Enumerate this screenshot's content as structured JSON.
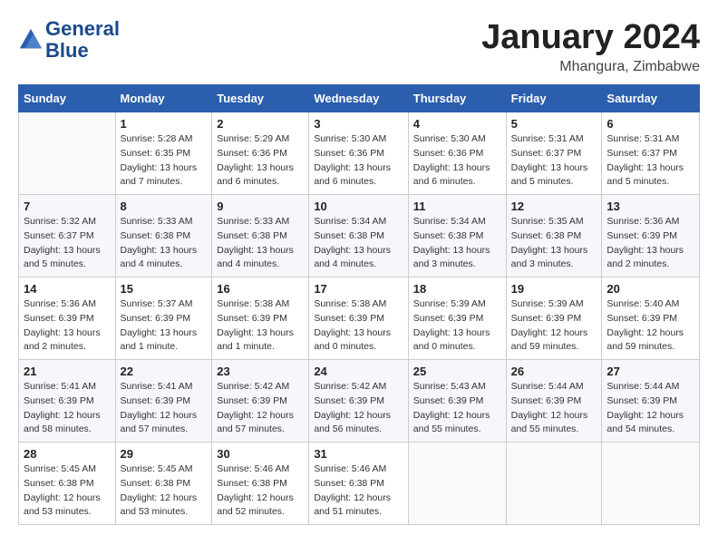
{
  "header": {
    "logo_line1": "General",
    "logo_line2": "Blue",
    "month": "January 2024",
    "location": "Mhangura, Zimbabwe"
  },
  "weekdays": [
    "Sunday",
    "Monday",
    "Tuesday",
    "Wednesday",
    "Thursday",
    "Friday",
    "Saturday"
  ],
  "weeks": [
    [
      {
        "day": "",
        "info": ""
      },
      {
        "day": "1",
        "info": "Sunrise: 5:28 AM\nSunset: 6:35 PM\nDaylight: 13 hours\nand 7 minutes."
      },
      {
        "day": "2",
        "info": "Sunrise: 5:29 AM\nSunset: 6:36 PM\nDaylight: 13 hours\nand 6 minutes."
      },
      {
        "day": "3",
        "info": "Sunrise: 5:30 AM\nSunset: 6:36 PM\nDaylight: 13 hours\nand 6 minutes."
      },
      {
        "day": "4",
        "info": "Sunrise: 5:30 AM\nSunset: 6:36 PM\nDaylight: 13 hours\nand 6 minutes."
      },
      {
        "day": "5",
        "info": "Sunrise: 5:31 AM\nSunset: 6:37 PM\nDaylight: 13 hours\nand 5 minutes."
      },
      {
        "day": "6",
        "info": "Sunrise: 5:31 AM\nSunset: 6:37 PM\nDaylight: 13 hours\nand 5 minutes."
      }
    ],
    [
      {
        "day": "7",
        "info": "Sunrise: 5:32 AM\nSunset: 6:37 PM\nDaylight: 13 hours\nand 5 minutes."
      },
      {
        "day": "8",
        "info": "Sunrise: 5:33 AM\nSunset: 6:38 PM\nDaylight: 13 hours\nand 4 minutes."
      },
      {
        "day": "9",
        "info": "Sunrise: 5:33 AM\nSunset: 6:38 PM\nDaylight: 13 hours\nand 4 minutes."
      },
      {
        "day": "10",
        "info": "Sunrise: 5:34 AM\nSunset: 6:38 PM\nDaylight: 13 hours\nand 4 minutes."
      },
      {
        "day": "11",
        "info": "Sunrise: 5:34 AM\nSunset: 6:38 PM\nDaylight: 13 hours\nand 3 minutes."
      },
      {
        "day": "12",
        "info": "Sunrise: 5:35 AM\nSunset: 6:38 PM\nDaylight: 13 hours\nand 3 minutes."
      },
      {
        "day": "13",
        "info": "Sunrise: 5:36 AM\nSunset: 6:39 PM\nDaylight: 13 hours\nand 2 minutes."
      }
    ],
    [
      {
        "day": "14",
        "info": "Sunrise: 5:36 AM\nSunset: 6:39 PM\nDaylight: 13 hours\nand 2 minutes."
      },
      {
        "day": "15",
        "info": "Sunrise: 5:37 AM\nSunset: 6:39 PM\nDaylight: 13 hours\nand 1 minute."
      },
      {
        "day": "16",
        "info": "Sunrise: 5:38 AM\nSunset: 6:39 PM\nDaylight: 13 hours\nand 1 minute."
      },
      {
        "day": "17",
        "info": "Sunrise: 5:38 AM\nSunset: 6:39 PM\nDaylight: 13 hours\nand 0 minutes."
      },
      {
        "day": "18",
        "info": "Sunrise: 5:39 AM\nSunset: 6:39 PM\nDaylight: 13 hours\nand 0 minutes."
      },
      {
        "day": "19",
        "info": "Sunrise: 5:39 AM\nSunset: 6:39 PM\nDaylight: 12 hours\nand 59 minutes."
      },
      {
        "day": "20",
        "info": "Sunrise: 5:40 AM\nSunset: 6:39 PM\nDaylight: 12 hours\nand 59 minutes."
      }
    ],
    [
      {
        "day": "21",
        "info": "Sunrise: 5:41 AM\nSunset: 6:39 PM\nDaylight: 12 hours\nand 58 minutes."
      },
      {
        "day": "22",
        "info": "Sunrise: 5:41 AM\nSunset: 6:39 PM\nDaylight: 12 hours\nand 57 minutes."
      },
      {
        "day": "23",
        "info": "Sunrise: 5:42 AM\nSunset: 6:39 PM\nDaylight: 12 hours\nand 57 minutes."
      },
      {
        "day": "24",
        "info": "Sunrise: 5:42 AM\nSunset: 6:39 PM\nDaylight: 12 hours\nand 56 minutes."
      },
      {
        "day": "25",
        "info": "Sunrise: 5:43 AM\nSunset: 6:39 PM\nDaylight: 12 hours\nand 55 minutes."
      },
      {
        "day": "26",
        "info": "Sunrise: 5:44 AM\nSunset: 6:39 PM\nDaylight: 12 hours\nand 55 minutes."
      },
      {
        "day": "27",
        "info": "Sunrise: 5:44 AM\nSunset: 6:39 PM\nDaylight: 12 hours\nand 54 minutes."
      }
    ],
    [
      {
        "day": "28",
        "info": "Sunrise: 5:45 AM\nSunset: 6:38 PM\nDaylight: 12 hours\nand 53 minutes."
      },
      {
        "day": "29",
        "info": "Sunrise: 5:45 AM\nSunset: 6:38 PM\nDaylight: 12 hours\nand 53 minutes."
      },
      {
        "day": "30",
        "info": "Sunrise: 5:46 AM\nSunset: 6:38 PM\nDaylight: 12 hours\nand 52 minutes."
      },
      {
        "day": "31",
        "info": "Sunrise: 5:46 AM\nSunset: 6:38 PM\nDaylight: 12 hours\nand 51 minutes."
      },
      {
        "day": "",
        "info": ""
      },
      {
        "day": "",
        "info": ""
      },
      {
        "day": "",
        "info": ""
      }
    ]
  ]
}
